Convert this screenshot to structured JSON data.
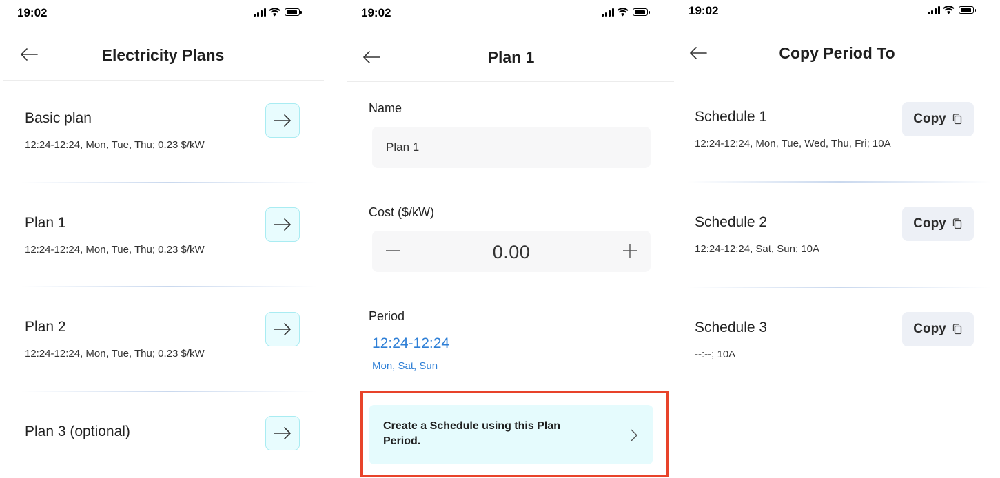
{
  "status_bar": {
    "time": "19:02"
  },
  "screen1": {
    "title": "Electricity Plans",
    "plans": [
      {
        "name": "Basic plan",
        "summary": "12:24-12:24, Mon, Tue, Thu; 0.23 $/kW"
      },
      {
        "name": "Plan 1",
        "summary": "12:24-12:24, Mon, Tue, Thu; 0.23 $/kW"
      },
      {
        "name": "Plan 2",
        "summary": "12:24-12:24, Mon, Tue, Thu; 0.23 $/kW"
      },
      {
        "name": "Plan 3 (optional)",
        "summary": ""
      }
    ]
  },
  "screen2": {
    "title": "Plan 1",
    "name_label": "Name",
    "name_value": "Plan 1",
    "cost_label": "Cost ($/kW)",
    "cost_value": "0.00",
    "period_label": "Period",
    "period_time": "12:24-12:24",
    "period_days": "Mon, Sat, Sun",
    "create_schedule_label": "Create a Schedule using this Plan Period."
  },
  "screen3": {
    "title": "Copy Period To",
    "copy_label": "Copy",
    "schedules": [
      {
        "name": "Schedule 1",
        "summary": "12:24-12:24, Mon, Tue, Wed, Thu, Fri; 10A"
      },
      {
        "name": "Schedule 2",
        "summary": "12:24-12:24, Sat, Sun; 10A"
      },
      {
        "name": "Schedule 3",
        "summary": "--:--; 10A"
      }
    ]
  },
  "colors": {
    "accent_blue": "#2e7fd6",
    "cyan_button_bg": "#e8fcfe",
    "highlight_red": "#e8432a",
    "copy_button_bg": "#edf0f6"
  },
  "icons": [
    "back-arrow-icon",
    "right-arrow-icon",
    "minus-icon",
    "plus-icon",
    "chevron-right-icon",
    "copy-icon",
    "signal-icon",
    "wifi-icon",
    "battery-icon"
  ]
}
